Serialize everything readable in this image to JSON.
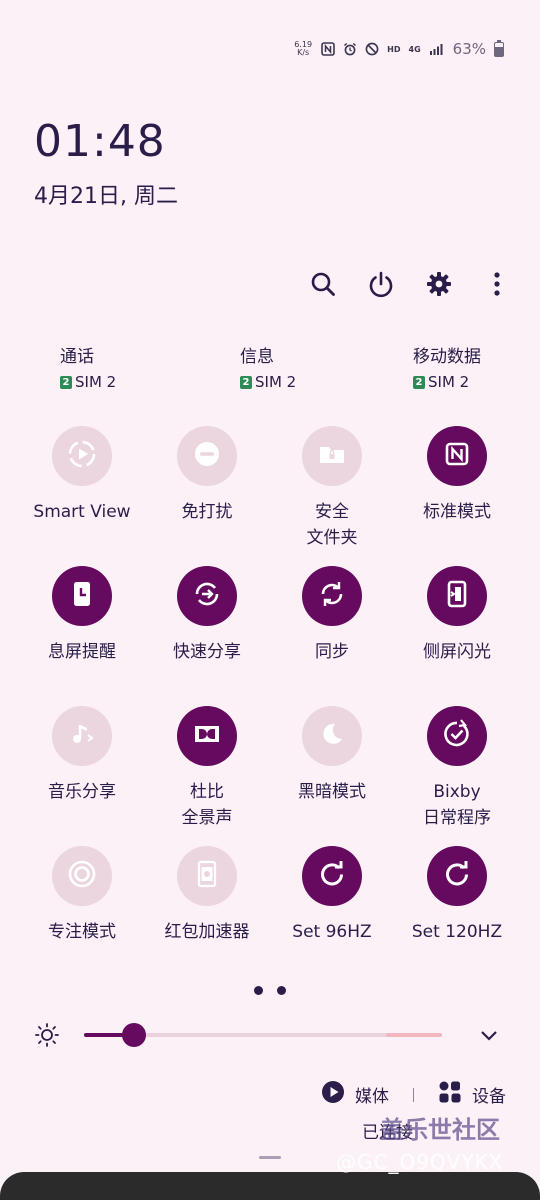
{
  "status_bar": {
    "net_speed_value": "6.19",
    "net_speed_unit": "K/s",
    "hd": "HD",
    "network": "4G",
    "battery": "63%",
    "battery_level": 0.63,
    "icons": [
      "nfc-icon",
      "alarm-icon",
      "do-not-disturb-icon",
      "signal-icon",
      "battery-icon"
    ]
  },
  "clock": {
    "time": "01:48",
    "date": "4月21日, 周二"
  },
  "toolbar": {
    "icons": [
      "search-icon",
      "power-icon",
      "gear-icon",
      "more-vert-icon"
    ]
  },
  "sim_settings": [
    {
      "label": "通话",
      "sim_badge": "2",
      "sim": "SIM 2"
    },
    {
      "label": "信息",
      "sim_badge": "2",
      "sim": "SIM 2"
    },
    {
      "label": "移动数据",
      "sim_badge": "2",
      "sim": "SIM 2"
    }
  ],
  "tiles": [
    {
      "label": "Smart View",
      "icon": "smart-view-icon",
      "on": false
    },
    {
      "label": "免打扰",
      "icon": "do-not-disturb-icon",
      "on": false
    },
    {
      "label": "安全\n文件夹",
      "icon": "secure-folder-icon",
      "on": false
    },
    {
      "label": "标准模式",
      "icon": "nfc-icon",
      "on": true
    },
    {
      "label": "息屏提醒",
      "icon": "always-on-display-icon",
      "on": true
    },
    {
      "label": "快速分享",
      "icon": "quick-share-icon",
      "on": true
    },
    {
      "label": "同步",
      "icon": "sync-icon",
      "on": true
    },
    {
      "label": "侧屏闪光",
      "icon": "edge-lighting-icon",
      "on": true
    },
    {
      "label": "音乐分享",
      "icon": "music-share-icon",
      "on": false
    },
    {
      "label": "杜比\n全景声",
      "icon": "dolby-icon",
      "on": true
    },
    {
      "label": "黑暗模式",
      "icon": "moon-icon",
      "on": false
    },
    {
      "label": "Bixby\n日常程序",
      "icon": "bixby-routines-icon",
      "on": true
    },
    {
      "label": "专注模式",
      "icon": "focus-mode-icon",
      "on": false
    },
    {
      "label": "红包加速器",
      "icon": "red-envelope-icon",
      "on": false
    },
    {
      "label": "Set 96HZ",
      "icon": "refresh-icon",
      "on": true
    },
    {
      "label": "Set 120HZ",
      "icon": "refresh-icon",
      "on": true
    }
  ],
  "pager": {
    "pages": 2
  },
  "brightness": {
    "level": 0.14
  },
  "media": {
    "media_label": "媒体",
    "device_label": "设备"
  },
  "connected_text": "已连接",
  "watermark": {
    "brand": "盖乐世社区",
    "user": "@GC_O9QVYKX"
  },
  "colors": {
    "accent": "#650a5e",
    "tile_off": "#ebd6df",
    "background": "#fbf1f6",
    "text": "#2a1d4a"
  }
}
